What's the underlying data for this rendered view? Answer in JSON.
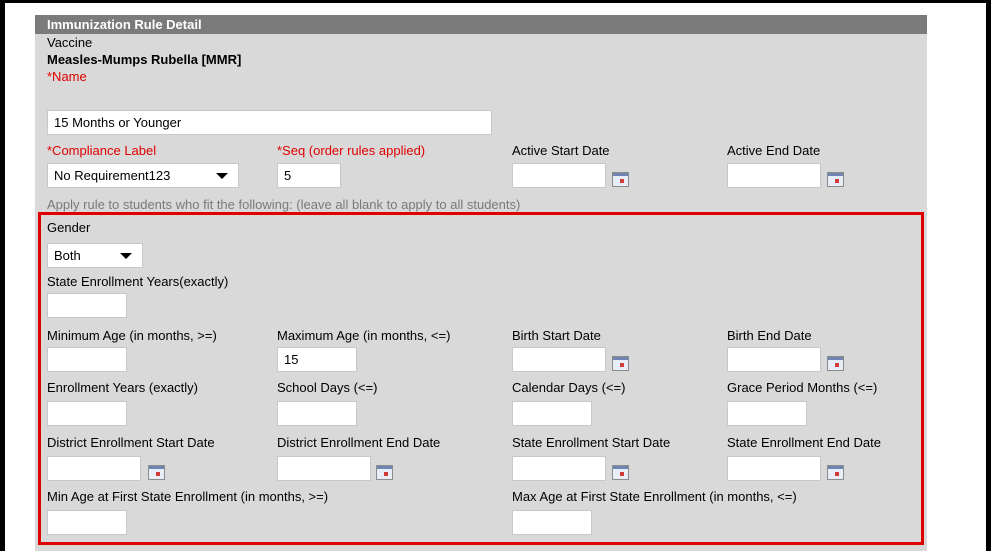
{
  "panel_title": "Immunization Rule Detail",
  "vaccine": {
    "label": "Vaccine",
    "value": "Measles-Mumps Rubella [MMR]"
  },
  "name_field": {
    "label": "*Name",
    "value": "15 Months or Younger"
  },
  "compliance": {
    "label": "*Compliance Label",
    "value": "No Requirement123"
  },
  "seq": {
    "label": "*Seq (order rules applied)",
    "value": "5"
  },
  "active_start": {
    "label": "Active Start Date",
    "value": ""
  },
  "active_end": {
    "label": "Active End Date",
    "value": ""
  },
  "apply_note": "Apply rule to students who fit the following: (leave all blank to apply to all students)",
  "criteria": {
    "gender": {
      "label": "Gender",
      "value": "Both"
    },
    "state_enroll_years": {
      "label": "State Enrollment Years(exactly)",
      "value": ""
    },
    "min_age": {
      "label": "Minimum Age (in months, >=)",
      "value": ""
    },
    "max_age": {
      "label": "Maximum Age (in months, <=)",
      "value": "15"
    },
    "birth_start": {
      "label": "Birth Start Date",
      "value": ""
    },
    "birth_end": {
      "label": "Birth End Date",
      "value": ""
    },
    "enroll_years": {
      "label": "Enrollment Years (exactly)",
      "value": ""
    },
    "school_days": {
      "label": "School Days (<=)",
      "value": ""
    },
    "calendar_days": {
      "label": "Calendar Days (<=)",
      "value": ""
    },
    "grace_months": {
      "label": "Grace Period Months (<=)",
      "value": ""
    },
    "district_start": {
      "label": "District Enrollment Start Date",
      "value": ""
    },
    "district_end": {
      "label": "District Enrollment End Date",
      "value": ""
    },
    "state_start": {
      "label": "State Enrollment Start Date",
      "value": ""
    },
    "state_end": {
      "label": "State Enrollment End Date",
      "value": ""
    },
    "min_age_first": {
      "label": "Min Age at First State Enrollment (in months, >=)",
      "value": ""
    },
    "max_age_first": {
      "label": "Max Age at First State Enrollment (in months, <=)",
      "value": ""
    }
  },
  "icons": {
    "calendar": "calendar-icon",
    "dropdown": "chevron-down-icon"
  },
  "colors": {
    "required": "#e00000",
    "header": "#7b7b7b",
    "panel": "#d9d9d9",
    "highlight": "#e00000"
  }
}
